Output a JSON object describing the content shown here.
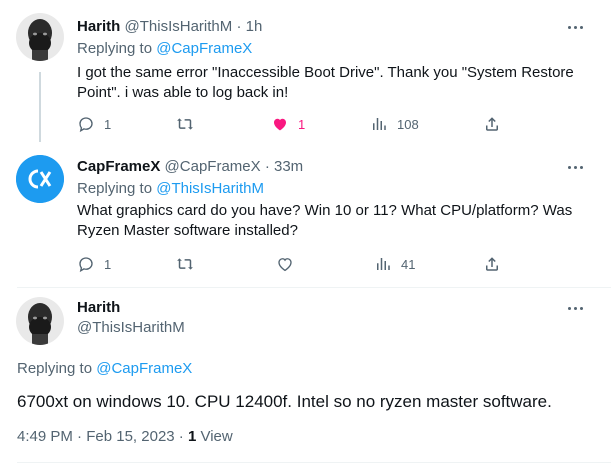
{
  "tweets": [
    {
      "name": "Harith",
      "handle": "@ThisIsHarithM",
      "time": "1h",
      "replying_prefix": "Replying to",
      "replying_to": "@CapFrameX",
      "text": "I got the same error \"Inaccessible Boot Drive\". Thank you \"System Restore Point\". i was able to log back in!",
      "actions": {
        "replies": "1",
        "retweets": "",
        "likes": "1",
        "views": "108"
      },
      "liked": true
    },
    {
      "name": "CapFrameX",
      "handle": "@CapFrameX",
      "time": "33m",
      "replying_prefix": "Replying to",
      "replying_to": "@ThisIsHarithM",
      "text": "What graphics card do you have? Win 10 or 11? What CPU/platform? Was Ryzen Master software installed?",
      "actions": {
        "replies": "1",
        "retweets": "",
        "likes": "",
        "views": "41"
      },
      "liked": false
    }
  ],
  "main_tweet": {
    "name": "Harith",
    "handle": "@ThisIsHarithM",
    "replying_prefix": "Replying to",
    "replying_to": "@CapFrameX",
    "text": "6700xt on windows 10. CPU 12400f. Intel so no ryzen master software.",
    "time": "4:49 PM",
    "date": "Feb 15, 2023",
    "views_count": "1",
    "views_label": "View"
  },
  "separator": "·",
  "colors": {
    "accent": "#1d9bf0",
    "like": "#f91880",
    "muted": "#536471",
    "text": "#0f1419",
    "capframex_logo": "#1d9bf0"
  }
}
